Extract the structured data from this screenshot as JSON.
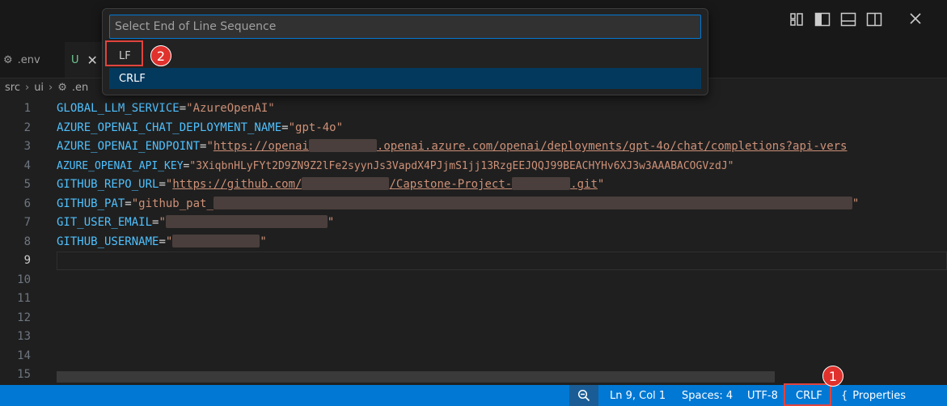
{
  "tabs": [
    {
      "label": ".env"
    },
    {
      "label": "U",
      "close": "✕"
    }
  ],
  "breadcrumb": {
    "src": "src",
    "ui": "ui",
    "file": ".en"
  },
  "quick_pick": {
    "placeholder": "Select End of Line Sequence",
    "items": [
      {
        "label": "LF"
      },
      {
        "label": "CRLF"
      }
    ]
  },
  "callouts": [
    "1",
    "2"
  ],
  "editor": {
    "lines": [
      {
        "num": "1",
        "key": "GLOBAL_LLM_SERVICE",
        "value": "\"AzureOpenAI\""
      },
      {
        "num": "2",
        "key": "AZURE_OPENAI_CHAT_DEPLOYMENT_NAME",
        "value": "\"gpt-4o\""
      },
      {
        "num": "3",
        "key": "AZURE_OPENAI_ENDPOINT",
        "value_a": "https://openai",
        "value_b": ".openai.azure.com/openai/deployments/gpt-4o/chat/completions?api-vers"
      },
      {
        "num": "4",
        "key": "AZURE_OPENAI_API_KEY",
        "value": "\"3XiqbnHLyFYt2D9ZN9Z2lFe2syynJs3VapdX4PJjmS1jj13RzgEEJQQJ99BEACHYHv6XJ3w3AAABACOGVzdJ\""
      },
      {
        "num": "5",
        "key": "GITHUB_REPO_URL",
        "value_a": "https://github.com/",
        "value_b": "/Capstone-Project-",
        "value_c": ".git"
      },
      {
        "num": "6",
        "key": "GITHUB_PAT",
        "value_a": "\"github_pat_"
      },
      {
        "num": "7",
        "key": "GIT_USER_EMAIL"
      },
      {
        "num": "8",
        "key": "GITHUB_USERNAME"
      },
      {
        "num": "9"
      },
      {
        "num": "10"
      },
      {
        "num": "11"
      },
      {
        "num": "12"
      },
      {
        "num": "13"
      },
      {
        "num": "14"
      },
      {
        "num": "15"
      }
    ]
  },
  "statusbar": {
    "position": "Ln 9, Col 1",
    "spaces": "Spaces: 4",
    "encoding": "UTF-8",
    "eol": "CRLF",
    "language": "Properties"
  },
  "colors": {
    "accent": "#0078d4",
    "highlight": "#e0443e",
    "key": "#4fc1ff",
    "string": "#ce9178"
  }
}
